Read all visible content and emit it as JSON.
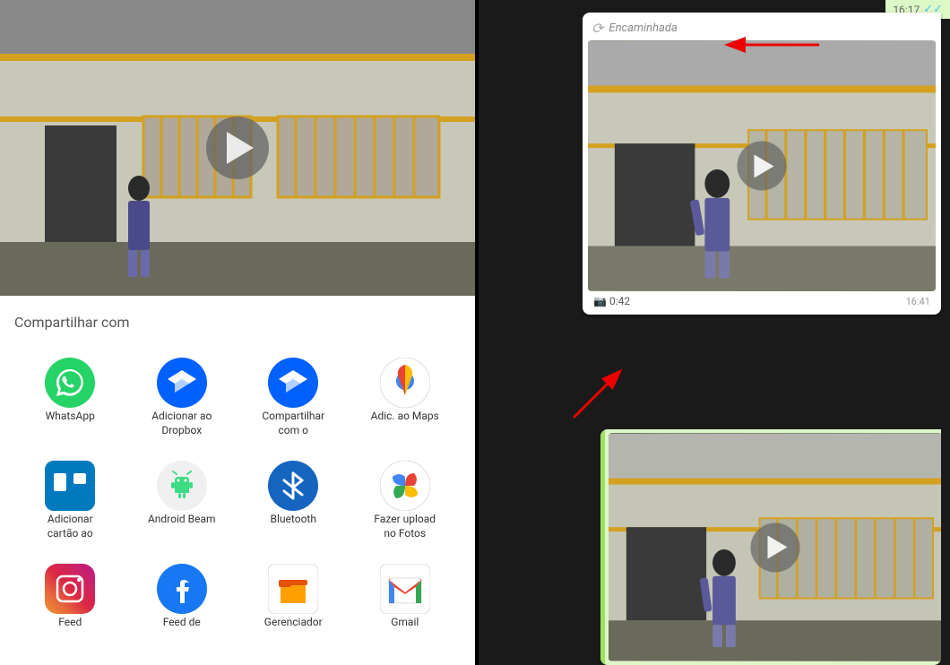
{
  "left": {
    "share_title": "Compartilhar com",
    "apps": [
      {
        "id": "whatsapp",
        "label": "WhatsApp",
        "color": "#25D366",
        "icon_type": "whatsapp"
      },
      {
        "id": "dropbox-add",
        "label": "Adicionar ao\nDropbox",
        "color": "#0061FF",
        "icon_type": "dropbox"
      },
      {
        "id": "dropbox-share",
        "label": "Compartilhar\ncom o",
        "color": "#0061FF",
        "icon_type": "dropbox"
      },
      {
        "id": "maps",
        "label": "Adic. ao Maps",
        "color": "#transparent",
        "icon_type": "maps"
      },
      {
        "id": "trello",
        "label": "Adicionar\ncartão ao",
        "color": "#0079BF",
        "icon_type": "trello"
      },
      {
        "id": "android-beam",
        "label": "Android Beam",
        "color": "#fff",
        "icon_type": "android"
      },
      {
        "id": "bluetooth",
        "label": "Bluetooth",
        "color": "#1565C0",
        "icon_type": "bluetooth"
      },
      {
        "id": "photos",
        "label": "Fazer upload\nno Fotos",
        "color": "#transparent",
        "icon_type": "photos"
      },
      {
        "id": "instagram",
        "label": "Feed",
        "color": "gradient",
        "icon_type": "instagram"
      },
      {
        "id": "facebook",
        "label": "Feed de",
        "color": "#1877F2",
        "icon_type": "facebook"
      },
      {
        "id": "files",
        "label": "Gerenciador",
        "color": "#fff",
        "icon_type": "files"
      },
      {
        "id": "gmail",
        "label": "Gmail",
        "color": "#fff",
        "icon_type": "gmail"
      }
    ]
  },
  "right": {
    "top_time": "16:17",
    "forwarded_label": "Encaminhada",
    "video_duration": "0:42",
    "video_time": "16:41"
  }
}
